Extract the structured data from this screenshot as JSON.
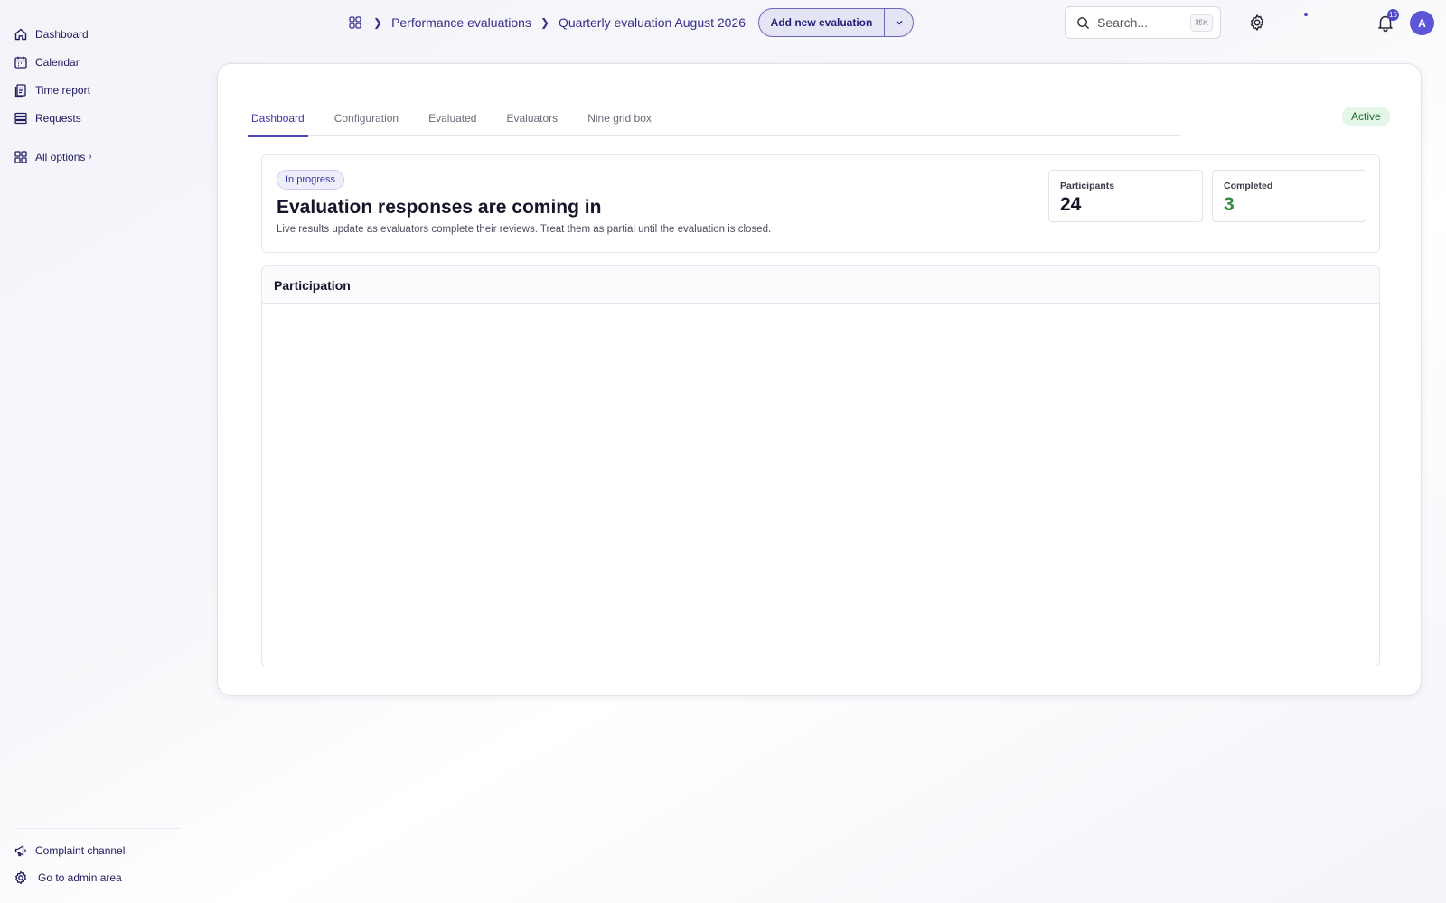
{
  "sidebar": {
    "items": [
      {
        "label": "Dashboard",
        "icon": "home-icon"
      },
      {
        "label": "Calendar",
        "icon": "calendar-icon"
      },
      {
        "label": "Time report",
        "icon": "clipboard-icon"
      },
      {
        "label": "Requests",
        "icon": "stack-icon"
      }
    ],
    "all_options": "All options",
    "bottom": [
      {
        "label": "Complaint channel",
        "icon": "megaphone-icon"
      },
      {
        "label": "Go to admin area",
        "icon": "gear-icon"
      }
    ]
  },
  "header": {
    "breadcrumb": [
      "Performance evaluations",
      "Quarterly evaluation August 2026"
    ],
    "add_button": "Add new evaluation",
    "search_placeholder": "Search...",
    "search_shortcut": "⌘K",
    "notifications_count": "15",
    "avatar_initial": "A"
  },
  "tabs": [
    {
      "label": "Dashboard",
      "active": true
    },
    {
      "label": "Configuration",
      "active": false
    },
    {
      "label": "Evaluated",
      "active": false
    },
    {
      "label": "Evaluators",
      "active": false
    },
    {
      "label": "Nine grid box",
      "active": false
    }
  ],
  "status": {
    "badge": "Active",
    "pill": "In progress",
    "title": "Evaluation responses are coming in",
    "description": "Live results update as evaluators complete their reviews. Treat them as partial until the evaluation is closed."
  },
  "stats": [
    {
      "label": "Participants",
      "value": "24"
    },
    {
      "label": "Completed",
      "value": "3"
    }
  ],
  "participation": {
    "title": "Participation"
  },
  "colors": {
    "accent": "#4a45b7",
    "active_bg": "#e3f6e8",
    "completed": "#2f8a3c"
  }
}
